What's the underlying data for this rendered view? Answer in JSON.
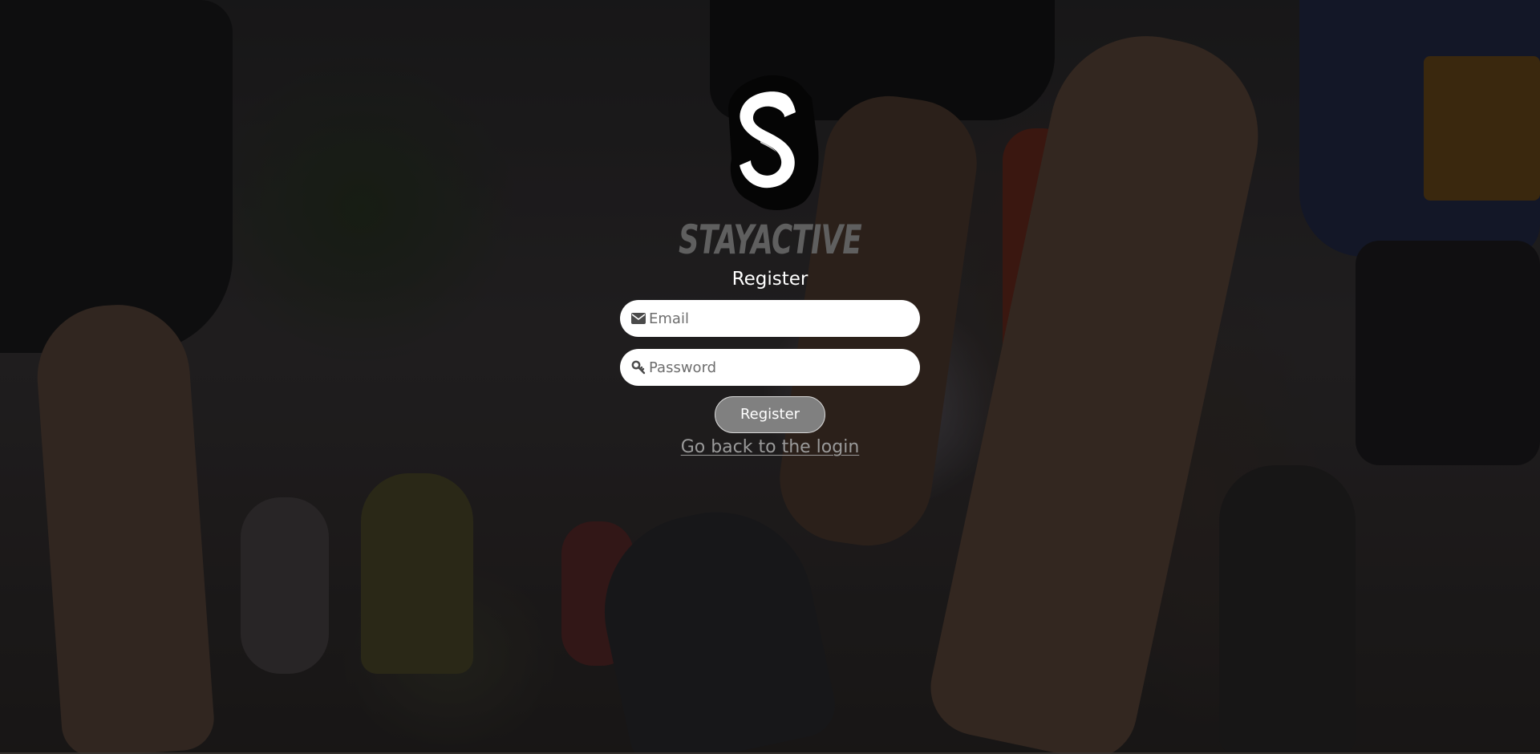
{
  "brand": {
    "logo_icon": "stayactive-s-logo",
    "wordmark": "STAYACTIVE",
    "wordmark_color": "#5f5f5f"
  },
  "form": {
    "title": "Register",
    "email": {
      "icon": "envelope-icon",
      "placeholder": "Email",
      "value": ""
    },
    "password": {
      "icon": "key-icon",
      "placeholder": "Password",
      "value": ""
    },
    "submit_label": "Register",
    "back_link": "Go back to the login"
  },
  "colors": {
    "button_bg": "#808080",
    "link": "#9a9a9a",
    "overlay": "rgba(0,0,0,0.45)"
  }
}
